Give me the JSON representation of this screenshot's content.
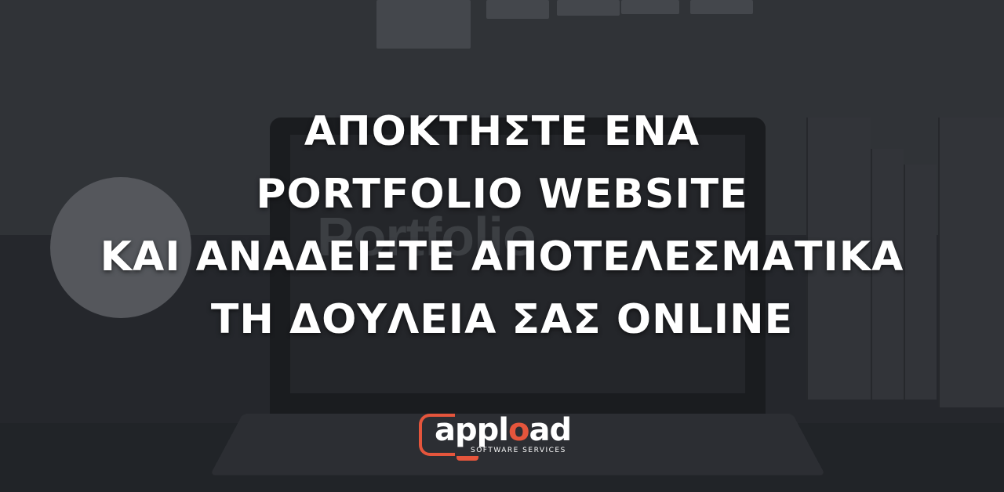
{
  "headline": {
    "line1": "ΑΠΟΚΤΗΣΤΕ ΕΝΑ",
    "line2": "PORTFOLIO WEBSITE",
    "line3": "ΚΑΙ ΑΝΑΔΕΙΞΤΕ ΑΠΟΤΕΛΕΣΜΑΤΙΚΑ",
    "line4": "ΤΗ ΔΟΥΛΕΙΑ ΣΑΣ ONLINE"
  },
  "background": {
    "screen_text": "Portfolio"
  },
  "logo": {
    "word_start": "appl",
    "word_o": "o",
    "word_end": "ad",
    "subtitle": "SOFTWARE SERVICES",
    "accent_color": "#e5553c"
  }
}
